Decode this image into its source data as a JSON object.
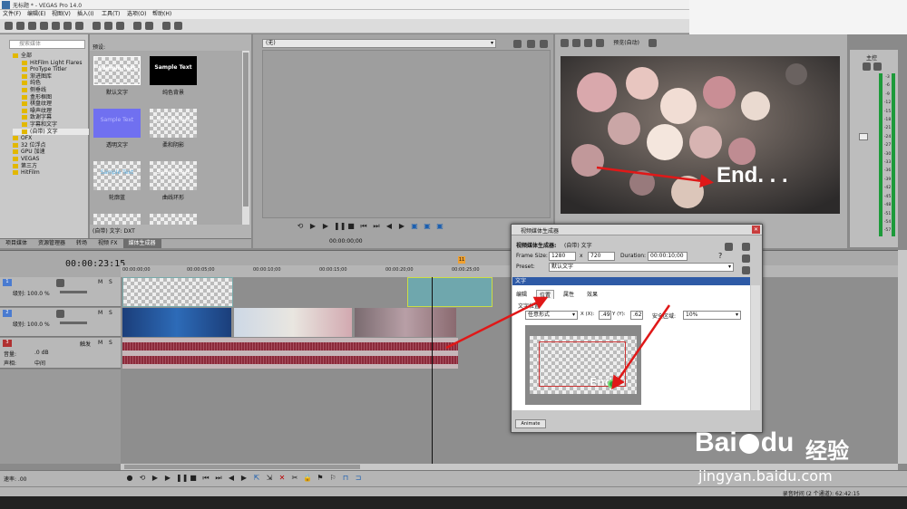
{
  "window": {
    "title": "无标题 * - VEGAS Pro 14.0"
  },
  "menu": [
    "文件(F)",
    "编辑(E)",
    "视图(V)",
    "插入(I)",
    "工具(T)",
    "选项(O)",
    "帮助(H)"
  ],
  "explorer": {
    "search_placeholder": "搜索媒体",
    "tree": [
      "全部",
      "HitFilm Light Flares",
      "ProType Titler",
      "渐进图库",
      "纯色",
      "侧垂线",
      "盒形框图",
      "棋盘纹理",
      "噪声纹理",
      "致谢字幕",
      "字幕和文字",
      "(自带) 文字",
      "OFX",
      "32 位浮点",
      "GPU 加速",
      "VEGAS",
      "第三方",
      "HitFilm"
    ],
    "preset_label": "预设:",
    "presets": [
      {
        "label": "默认文字",
        "thumb": "Sample Text"
      },
      {
        "label": "纯色背景",
        "thumb": "Sample Text"
      },
      {
        "label": "透明文字",
        "thumb": "Sample Text"
      },
      {
        "label": "柔和阴影",
        "thumb": "Sample Text"
      },
      {
        "label": "轮廓蓝",
        "thumb": "Sample Text"
      },
      {
        "label": "曲线环形",
        "thumb": "Sample Text"
      }
    ],
    "footer": "(自带) 文字: DXT",
    "tabs": [
      "项目媒体",
      "资源管理器",
      "转场",
      "视频 FX",
      "媒体生成器"
    ]
  },
  "trimmer": {
    "dropdown": "(无)",
    "timecode": "00:00:00;00"
  },
  "preview": {
    "mode": "预览(自动)",
    "overlay_text": "End. . ."
  },
  "master": {
    "label": "主控",
    "ticks": [
      "-3",
      "-6",
      "-9",
      "-12",
      "-15",
      "-18",
      "-21",
      "-24",
      "-27",
      "-30",
      "-33",
      "-36",
      "-39",
      "-42",
      "-45",
      "-48",
      "-51",
      "-54",
      "-57"
    ]
  },
  "timeline": {
    "timecode": "00:00:23:15",
    "ruler": [
      "00:00:00;00",
      "00:00:05;00",
      "00:00:10;00",
      "00:00:15;00",
      "00:00:20;00",
      "00:00:25;00"
    ],
    "marker": "11",
    "tracks": [
      {
        "num": "1",
        "level_label": "级别: 100.0 %",
        "mute": "M",
        "solo": "S"
      },
      {
        "num": "2",
        "level_label": "级别: 100.0 %",
        "mute": "M",
        "solo": "S"
      },
      {
        "num": "3",
        "vol_label": "音量:",
        "vol_value": ".0 dB",
        "pan_label": "声相:",
        "pan_value": "中间",
        "mute": "M",
        "solo": "S",
        "mode": "触发"
      }
    ],
    "rate_label": "速率: .00",
    "status": "录音时间 (2 个通道): 62:42:15"
  },
  "dialog": {
    "title": "视频媒体生成器",
    "heading": "视频媒体生成器:",
    "heading_value": "(自带) 文字",
    "frame_size_label": "Frame Size:",
    "width": "1280",
    "x": "x",
    "height": "720",
    "duration_label": "Duration:",
    "duration": "00:00:10;00",
    "preset_label": "Preset:",
    "preset_value": "默认文字",
    "section": "文字",
    "tabs": [
      "编辑",
      "位置",
      "属性",
      "效果"
    ],
    "group_label": "文字位置",
    "position_mode": "任意形式",
    "x_label": "X (X):",
    "x_value": ".49",
    "y_label": "Y (Y):",
    "y_value": ".62",
    "safe_label": "安全区域:",
    "safe_value": "10%",
    "preview_text": "End",
    "animate_btn": "Animate"
  },
  "watermark": {
    "brand": "Bai",
    "brand2": "du",
    "cn": "经验",
    "url": "jingyan.baidu.com"
  },
  "colors": {
    "arrow": "#e01818",
    "accent_green": "#2f9e3a",
    "audio": "#8b2a3a"
  }
}
